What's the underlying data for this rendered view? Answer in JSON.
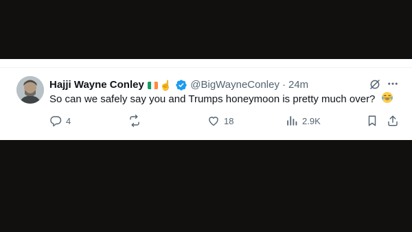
{
  "tweet": {
    "display_name": "Hajji Wayne Conley",
    "handle": "@BigWayneConley",
    "separator": "·",
    "time": "24m",
    "text": "So can we safely say you and Trumps honeymoon is pretty much over?",
    "emoji_finger": "☝️",
    "flag_colors": [
      "#169b62",
      "#ffffff",
      "#ff883e"
    ],
    "verified_color": "#1d9bf0"
  },
  "actions": {
    "replies": "4",
    "reposts": "",
    "likes": "18",
    "views": "2.9K"
  },
  "icons": {
    "verified": "verified-badge-icon",
    "grok": "grok-icon",
    "more": "more-icon",
    "reply": "reply-icon",
    "repost": "repost-icon",
    "like": "heart-icon",
    "views": "views-icon",
    "bookmark": "bookmark-icon",
    "share": "share-icon",
    "laugh": "laughing-emoji-icon"
  }
}
